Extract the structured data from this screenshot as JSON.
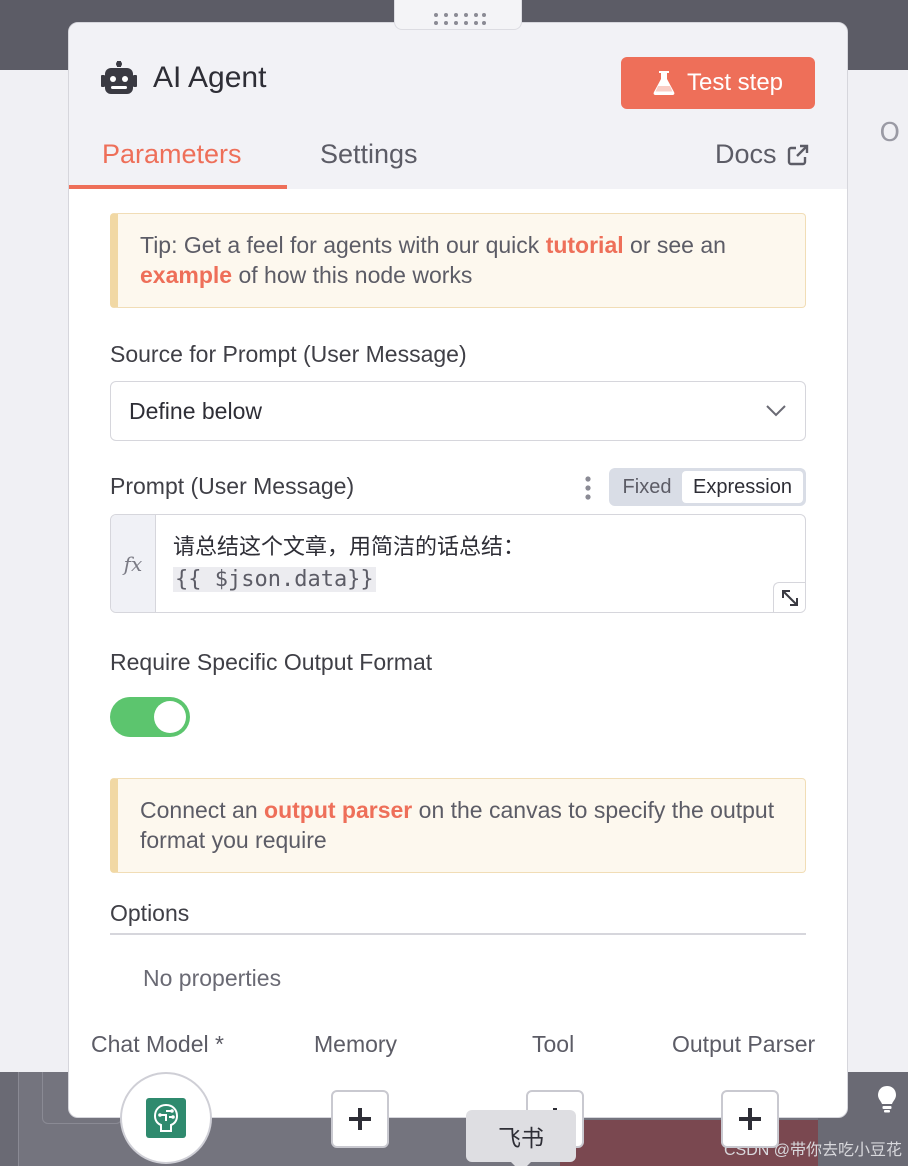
{
  "node": {
    "title": "AI Agent",
    "test_step_label": "Test step"
  },
  "tabs": {
    "parameters": "Parameters",
    "settings": "Settings",
    "docs": "Docs"
  },
  "tip": {
    "prefix": "Tip: Get a feel for agents with our quick ",
    "tutorial_link": "tutorial",
    "middle": " or see an ",
    "example_link": "example",
    "suffix": " of how this node works"
  },
  "source_prompt": {
    "label": "Source for Prompt (User Message)",
    "value": "Define below"
  },
  "prompt": {
    "label": "Prompt (User Message)",
    "mode_fixed": "Fixed",
    "mode_expression": "Expression",
    "fx_label": "fx",
    "line1": "请总结这个文章，用简洁的话总结：",
    "line2": "{{ $json.data}}"
  },
  "output_format": {
    "label": "Require Specific Output Format",
    "enabled": true
  },
  "output_hint": {
    "prefix": "Connect an ",
    "link": "output parser",
    "suffix": " on the canvas to specify the output format you require"
  },
  "options": {
    "label": "Options",
    "empty_text": "No properties"
  },
  "connections": {
    "chat_model": "Chat Model *",
    "memory": "Memory",
    "tool": "Tool",
    "output_parser": "Output Parser"
  },
  "tooltip": "飞书",
  "background": {
    "edge_letter": "O",
    "watermark": "CSDN @带你去吃小豆花"
  },
  "colors": {
    "accent": "#ee6f59",
    "toggle_on": "#5cc56e",
    "callout_bg": "#fdf8ee",
    "callout_border": "#f1d8a4"
  },
  "icons": [
    "robot-icon",
    "flask-icon",
    "external-link-icon",
    "chevron-down-icon",
    "kebab-icon",
    "expand-icon",
    "plus-icon",
    "openai-model-icon",
    "lightbulb-icon",
    "drag-handle-icon"
  ]
}
